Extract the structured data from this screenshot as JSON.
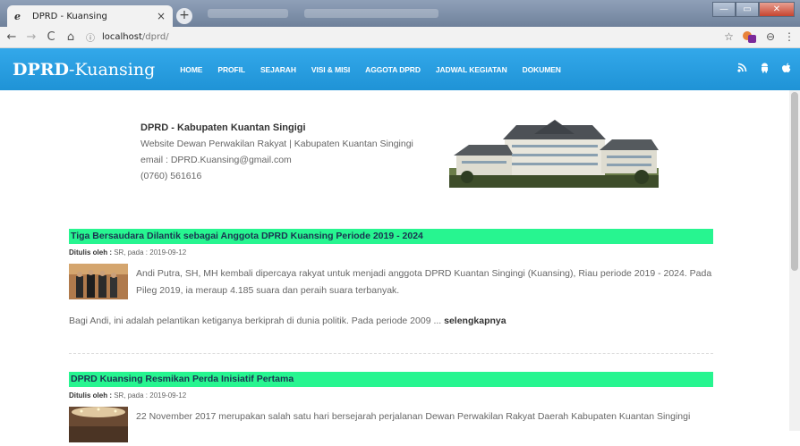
{
  "browser": {
    "tab_title": "DPRD - Kuansing",
    "tab_close": "×",
    "new_tab": "+",
    "url_host": "localhost",
    "url_path": "/dprd/",
    "icons": [
      "back-icon",
      "forward-icon",
      "reload-icon",
      "home-icon",
      "info-icon",
      "star-icon",
      "extension-icon",
      "profile-icon",
      "menu-icon"
    ]
  },
  "site": {
    "brand_bold": "DPRD",
    "brand_sep": "-",
    "brand_light": "Kuansing",
    "menu": [
      "HOME",
      "PROFIL",
      "SEJARAH",
      "VISI & MISI",
      "AGGOTA DPRD",
      "JADWAL KEGIATAN",
      "DOKUMEN"
    ],
    "social_icons": [
      "rss-icon",
      "android-icon",
      "apple-icon"
    ],
    "colors": {
      "header": "#2a9fe0",
      "title_bar": "#27f590"
    }
  },
  "intro": {
    "org": "DPRD - Kabupaten Kuantan Singigi",
    "tagline": "Website Dewan Perwakilan Rakyat | Kabupaten Kuantan Singingi",
    "email": "email : DPRD.Kuansing@gmail.com",
    "phone": "(0760) 561616"
  },
  "articles": [
    {
      "title": "Tiga Bersaudara Dilantik sebagai Anggota DPRD Kuansing Periode 2019 - 2024",
      "by_label": "Ditulis oleh :",
      "by_rest": " SR, pada : 2019-09-12",
      "text": "Andi Putra, SH, MH kembali dipercaya rakyat untuk menjadi anggota DPRD Kuantan Singingi (Kuansing), Riau periode 2019 - 2024. Pada Pileg 2019, ia meraup 4.185 suara dan peraih suara terbanyak.",
      "more": "Bagi Andi, ini adalah pelantikan ketiganya berkiprah di dunia politik. Pada periode 2009 ... ",
      "more_link": "selengkapnya"
    },
    {
      "title": "DPRD Kuansing Resmikan Perda Inisiatif Pertama",
      "by_label": "Ditulis oleh :",
      "by_rest": " SR, pada : 2019-09-12",
      "text": "22 November 2017 merupakan salah satu hari  bersejarah perjalanan Dewan Perwakilan Rakyat Daerah Kabupaten Kuantan Singingi"
    }
  ]
}
